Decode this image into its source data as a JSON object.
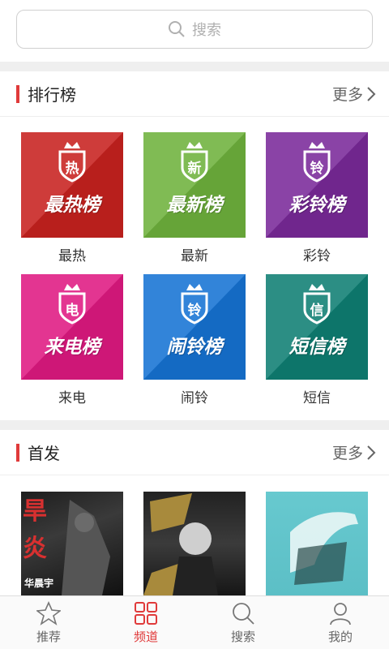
{
  "search": {
    "placeholder": "搜索"
  },
  "sections": {
    "ranking": {
      "title": "排行榜",
      "more": "更多"
    },
    "premiere": {
      "title": "首发",
      "more": "更多"
    }
  },
  "charts": [
    {
      "caption": "最热",
      "badge": "热",
      "name": "最热榜",
      "color": "#c8221f"
    },
    {
      "caption": "最新",
      "badge": "新",
      "name": "最新榜",
      "color": "#6fb23d"
    },
    {
      "caption": "彩铃",
      "badge": "铃",
      "name": "彩铃榜",
      "color": "#7a2a9a"
    },
    {
      "caption": "来电",
      "badge": "电",
      "name": "来电榜",
      "color": "#e01a82"
    },
    {
      "caption": "闹铃",
      "badge": "铃",
      "name": "闹铃榜",
      "color": "#1673d4"
    },
    {
      "caption": "短信",
      "badge": "信",
      "name": "短信榜",
      "color": "#0f7f74"
    }
  ],
  "albums": [
    {
      "text": "华晨宇"
    },
    {
      "text": ""
    },
    {
      "text": ""
    }
  ],
  "tabs": [
    {
      "label": "推荐",
      "icon": "star-icon"
    },
    {
      "label": "频道",
      "icon": "grid-icon",
      "active": true
    },
    {
      "label": "搜索",
      "icon": "search-icon"
    },
    {
      "label": "我的",
      "icon": "user-icon"
    }
  ],
  "colors": {
    "accent": "#e03a3a"
  }
}
